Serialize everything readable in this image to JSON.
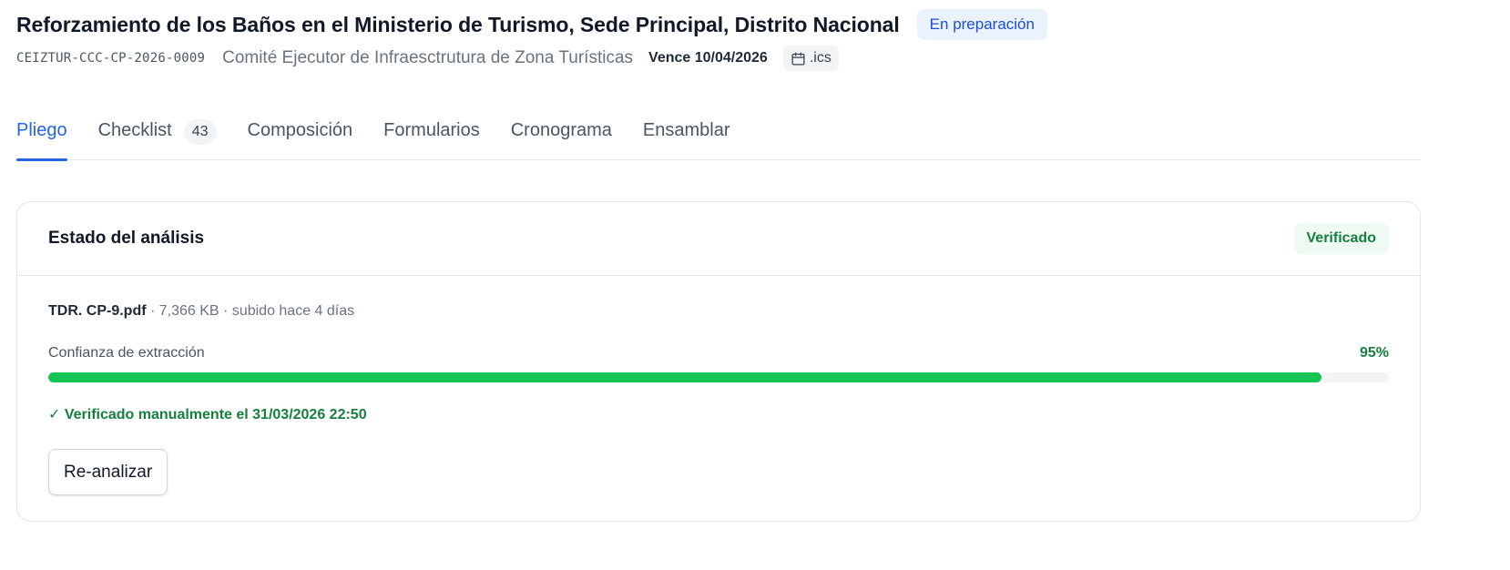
{
  "header": {
    "title": "Reforzamiento de los Baños en el Ministerio de Turismo, Sede Principal, Distrito Nacional",
    "status": "En preparación",
    "code": "CEIZTUR-CCC-CP-2026-0009",
    "committee": "Comité Ejecutor de Infraesctrutura de Zona Turísticas",
    "due": "Vence 10/04/2026",
    "ics_label": ".ics",
    "ics_icon": "calendar-icon"
  },
  "tabs": [
    {
      "label": "Pliego",
      "active": true
    },
    {
      "label": "Checklist",
      "badge": "43"
    },
    {
      "label": "Composición"
    },
    {
      "label": "Formularios"
    },
    {
      "label": "Cronograma"
    },
    {
      "label": "Ensamblar"
    }
  ],
  "analysis": {
    "title": "Estado del análisis",
    "status": "Verificado",
    "file_name": "TDR. CP-9.pdf",
    "file_meta": " · 7,366 KB · subido hace 4 días",
    "confidence_label": "Confianza de extracción",
    "confidence_value": "95%",
    "confidence_fraction": 0.95,
    "verified_text": "✓ Verificado manualmente el 31/03/2026 22:50",
    "reanalyze_label": "Re-analizar"
  },
  "colors": {
    "accent": "#2563eb",
    "success": "#15803d",
    "progress": "#16c456"
  }
}
